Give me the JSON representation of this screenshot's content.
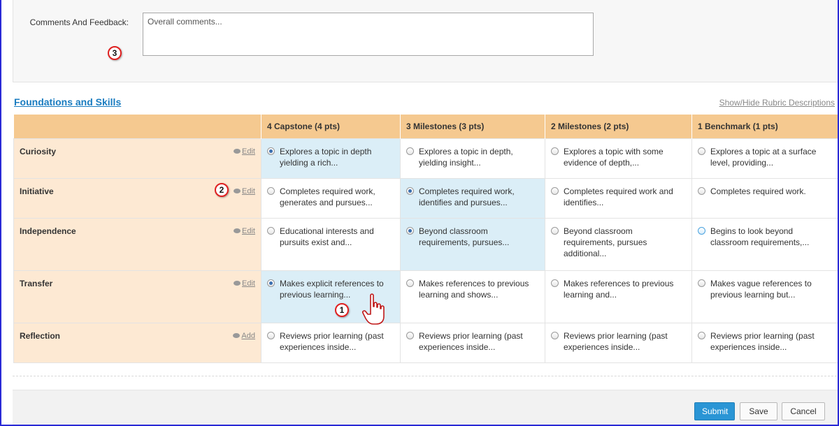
{
  "comments": {
    "label": "Comments And Feedback:",
    "placeholder": "Overall comments..."
  },
  "callouts": [
    "1",
    "2",
    "3"
  ],
  "section": {
    "title": "Foundations and Skills",
    "toggle_label": "Show/Hide Rubric Descriptions"
  },
  "rubric": {
    "levels": [
      "4 Capstone (4 pts)",
      "3 Milestones (3 pts)",
      "2 Milestones (2 pts)",
      "1 Benchmark (1 pts)"
    ],
    "rows": [
      {
        "criterion": "Curiosity",
        "action": "Edit",
        "cells": [
          "Explores a topic in depth yielding a rich...",
          "Explores a topic in depth, yielding insight...",
          "Explores a topic with some evidence of depth,...",
          "Explores a topic at a surface level, providing..."
        ]
      },
      {
        "criterion": "Initiative",
        "action": "Edit",
        "cells": [
          "Completes required work, generates and pursues...",
          "Completes required work, identifies and pursues...",
          "Completes required work and identifies...",
          "Completes required work."
        ]
      },
      {
        "criterion": "Independence",
        "action": "Edit",
        "cells": [
          "Educational interests and pursuits exist and...",
          "Beyond classroom requirements, pursues...",
          "Beyond classroom requirements, pursues additional...",
          "Begins to look beyond classroom requirements,..."
        ]
      },
      {
        "criterion": "Transfer",
        "action": "Edit",
        "cells": [
          "Makes explicit references to previous learning...",
          "Makes references to previous learning and shows...",
          "Makes references to previous learning and...",
          "Makes vague references to previous learning but..."
        ]
      },
      {
        "criterion": "Reflection",
        "action": "Add",
        "cells": [
          "Reviews prior learning (past experiences inside...",
          "Reviews prior learning (past experiences inside...",
          "Reviews prior learning (past experiences inside...",
          "Reviews prior learning (past experiences inside..."
        ]
      }
    ]
  },
  "buttons": {
    "submit": "Submit",
    "save": "Save",
    "cancel": "Cancel"
  },
  "colors": {
    "header_bg": "#f5c990",
    "criterion_bg": "#fde9d3",
    "selected_bg": "#dbeef7",
    "link": "#1a7cc0",
    "primary_button": "#2a95d5",
    "callout_border": "#e02020"
  },
  "icons": [
    "comment-bubble-icon",
    "hand-pointer-cursor-icon"
  ]
}
